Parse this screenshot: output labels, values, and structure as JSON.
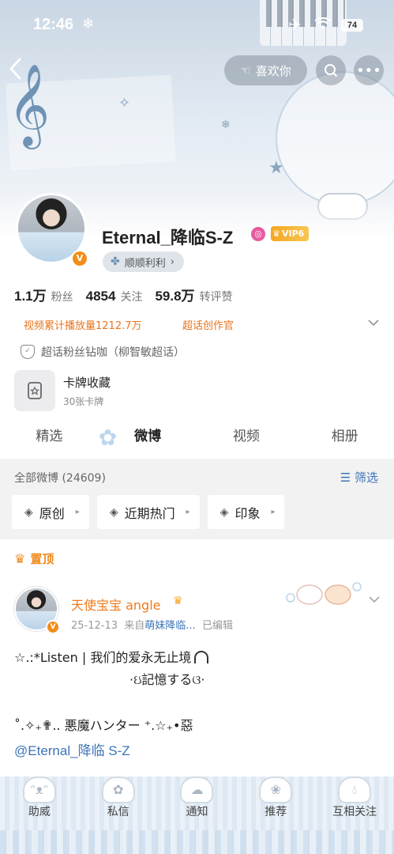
{
  "status_bar": {
    "time": "12:46",
    "battery": "74"
  },
  "nav": {
    "like_label": "喜欢你"
  },
  "profile": {
    "username": "Eternal_降临S-Z",
    "vip_label": "VIP6",
    "sub_label": "顺顺利利",
    "stats": [
      {
        "value": "1.1万",
        "label": "粉丝"
      },
      {
        "value": "4854",
        "label": "关注"
      },
      {
        "value": "59.8万",
        "label": "转评赞"
      }
    ],
    "video_plays": "视频累计播放量1212.7万",
    "supertopic_role": "超话创作官",
    "supertopic_fan": "超话粉丝钻咖（柳智敏超话）",
    "card_title": "卡牌收藏",
    "card_sub": "30张卡牌"
  },
  "tabs": [
    {
      "label": "精选",
      "active": false
    },
    {
      "label": "微博",
      "active": true
    },
    {
      "label": "视频",
      "active": false
    },
    {
      "label": "相册",
      "active": false
    }
  ],
  "filter": {
    "title": "全部微博 (24609)",
    "filter_label": "筛选",
    "chips": [
      "原创",
      "近期热门",
      "印象"
    ]
  },
  "post": {
    "pinned_label": "置顶",
    "author": "天使宝宝 angle",
    "date": "25-12-13",
    "source_prefix": "来自",
    "source": "萌妹降临...",
    "edited": "已编辑",
    "line1": "☆.:*Listen | 我们的爱永无止境",
    "line2": "·ઇ記憶するଓ·",
    "line3": "˚.✧₊✟.. 悪魔ハンター ⁺.☆₊•惡",
    "mention": "@Eternal_降临 S-Z"
  },
  "bottom_bar": [
    {
      "label": "助威",
      "icon": "cat-face-icon"
    },
    {
      "label": "私信",
      "icon": "flower-icon"
    },
    {
      "label": "通知",
      "icon": "cloud-icon"
    },
    {
      "label": "推荐",
      "icon": "paw-icon"
    },
    {
      "label": "互相关注",
      "icon": "drop-icon"
    }
  ],
  "colors": {
    "accent_orange": "#f08a1a",
    "link_blue": "#3d74b8",
    "vip_gold": "#f5a623"
  }
}
